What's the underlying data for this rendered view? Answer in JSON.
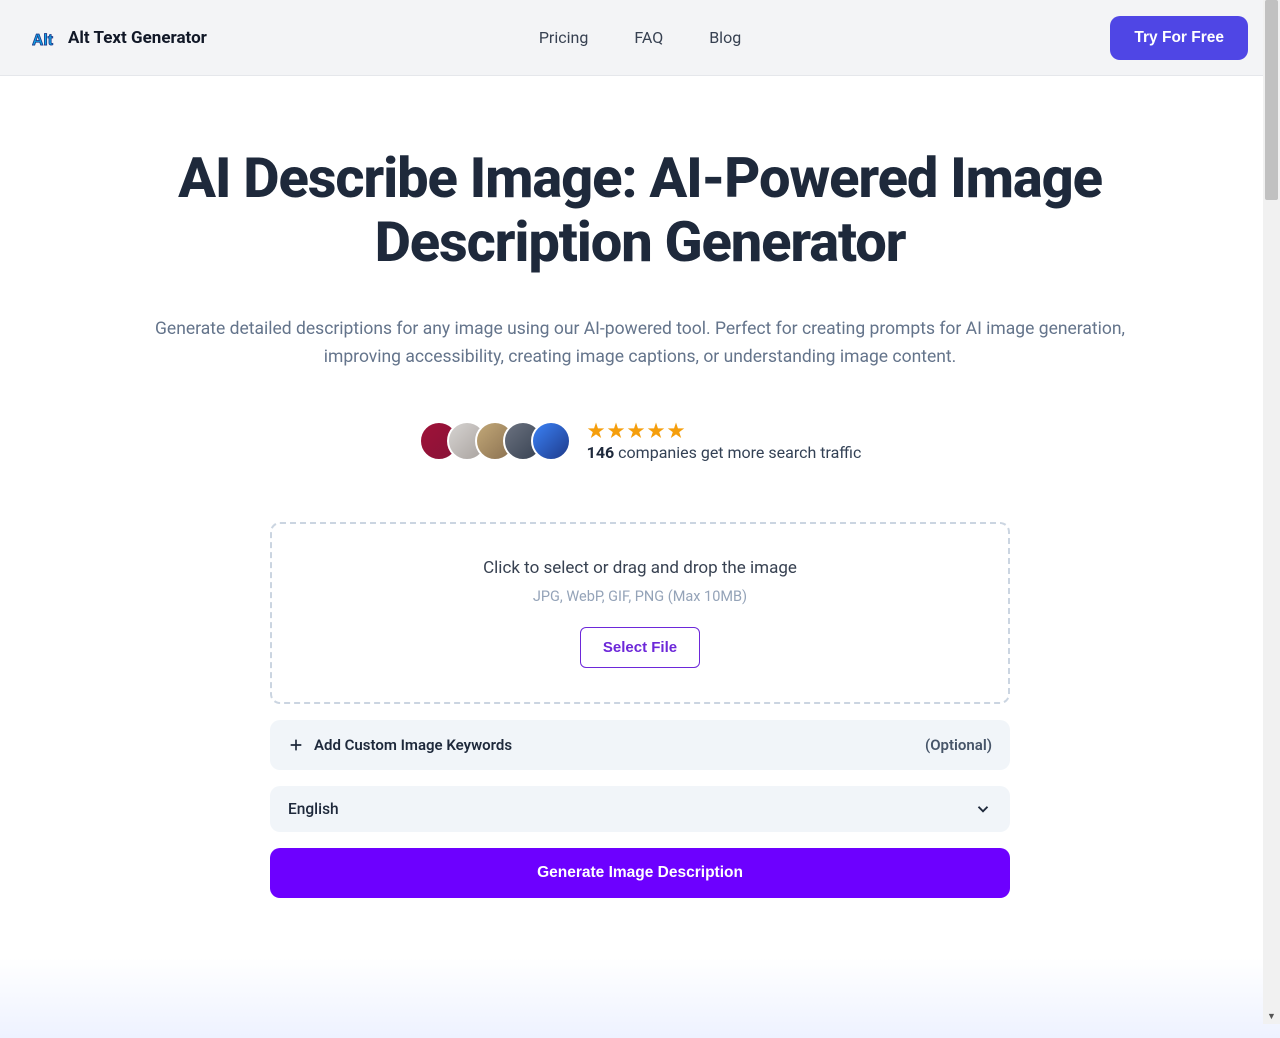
{
  "header": {
    "brand": "Alt Text Generator",
    "nav": {
      "pricing": "Pricing",
      "faq": "FAQ",
      "blog": "Blog"
    },
    "cta": "Try For Free"
  },
  "hero": {
    "title": "AI Describe Image: AI-Powered Image Description Generator",
    "subtitle": "Generate detailed descriptions for any image using our AI-powered tool. Perfect for creating prompts for AI image generation, improving accessibility, creating image captions, or understanding image content."
  },
  "social": {
    "count": "146",
    "text": " companies get more search traffic"
  },
  "dropzone": {
    "title": "Click to select or drag and drop the image",
    "hint": "JPG, WebP, GIF, PNG (Max 10MB)",
    "button": "Select File"
  },
  "keywords": {
    "label": "Add Custom Image Keywords",
    "optional": "(Optional)"
  },
  "language": {
    "selected": "English"
  },
  "generate": {
    "label": "Generate Image Description"
  }
}
